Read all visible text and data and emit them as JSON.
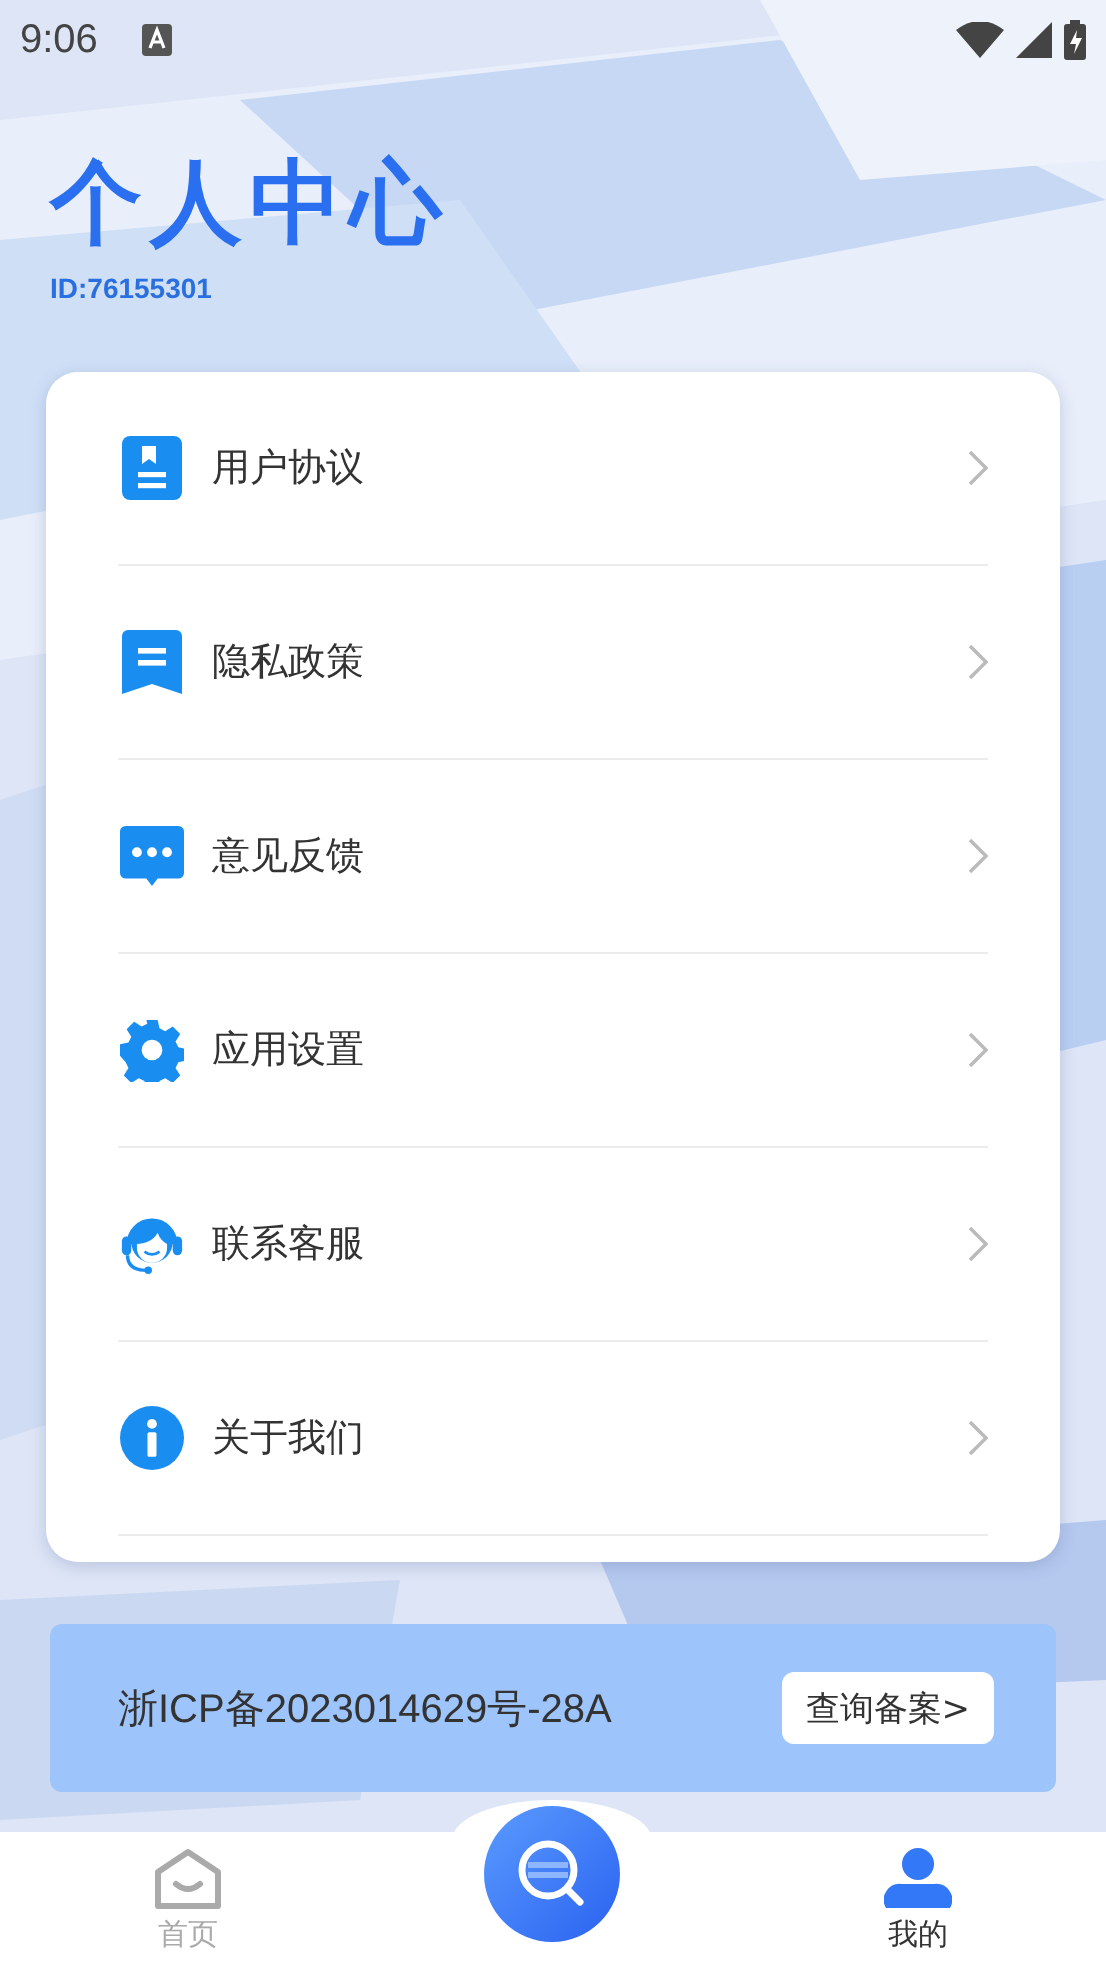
{
  "status_bar": {
    "time": "9:06"
  },
  "header": {
    "title": "个人中心",
    "user_id": "ID:76155301"
  },
  "menu": [
    {
      "label": "用户协议"
    },
    {
      "label": "隐私政策"
    },
    {
      "label": "意见反馈"
    },
    {
      "label": "应用设置"
    },
    {
      "label": "联系客服"
    },
    {
      "label": "关于我们"
    }
  ],
  "icp_banner": {
    "text": "浙ICP备2023014629号-28A",
    "button": "查询备案>"
  },
  "bottom_nav": [
    {
      "kind": "tab",
      "label": "首页",
      "selected": false
    },
    {
      "kind": "center",
      "selected": false
    },
    {
      "kind": "tab",
      "label": "我的",
      "selected": true
    }
  ]
}
